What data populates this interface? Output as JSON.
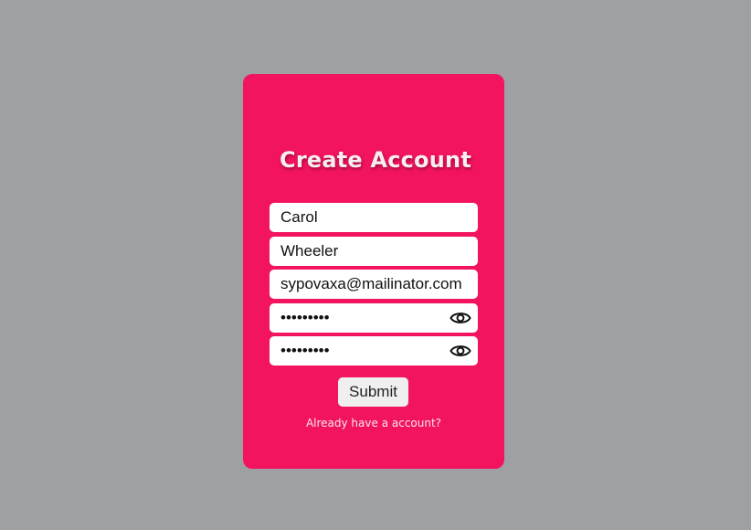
{
  "colors": {
    "page_background": "#9fa0a4",
    "card_background": "#f2145e",
    "field_background": "#ffffff",
    "button_background": "#efefef",
    "title_text": "#f7eef2"
  },
  "form": {
    "title": "Create Account",
    "first_name": {
      "value": "Carol"
    },
    "last_name": {
      "value": "Wheeler"
    },
    "email": {
      "value": "sypovaxa@mailinator.com"
    },
    "password": {
      "value": "•••••••••",
      "toggle_icon": "eye-icon"
    },
    "confirm_password": {
      "value": "•••••••••",
      "toggle_icon": "eye-icon"
    },
    "submit_label": "Submit",
    "login_link": "Already have a account?"
  }
}
